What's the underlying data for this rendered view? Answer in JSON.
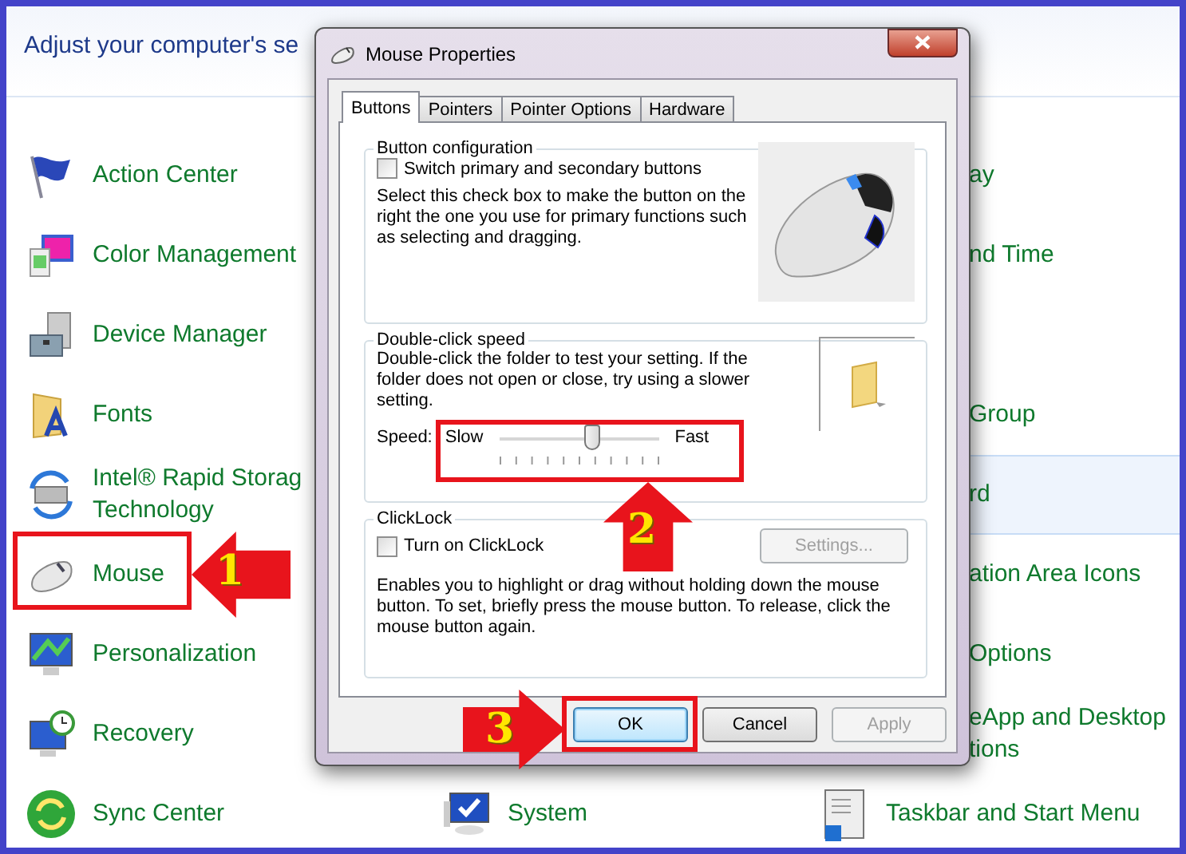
{
  "header": {
    "text": "Adjust your computer's se"
  },
  "rows": [
    {
      "left": {
        "lines": [
          "Action Center"
        ]
      },
      "right": {
        "kind": "clipped",
        "lines": [
          "ay"
        ],
        "highlighted": false
      }
    },
    {
      "left": {
        "lines": [
          "Color Management"
        ]
      },
      "right": {
        "kind": "clipped",
        "lines": [
          "nd Time"
        ],
        "highlighted": false
      }
    },
    {
      "left": {
        "lines": [
          "Device Manager"
        ]
      }
    },
    {
      "left": {
        "lines": [
          "Fonts"
        ]
      },
      "right": {
        "kind": "clipped",
        "lines": [
          "Group"
        ],
        "highlighted": false
      }
    },
    {
      "left": {
        "lines": [
          "Intel® Rapid Storag",
          "Technology"
        ]
      },
      "right": {
        "kind": "clipped",
        "lines": [
          "rd"
        ],
        "highlighted": true
      }
    },
    {
      "left": {
        "lines": [
          "Mouse"
        ]
      },
      "right": {
        "kind": "clipped",
        "lines": [
          "ation Area Icons"
        ],
        "highlighted": false
      }
    },
    {
      "left": {
        "lines": [
          "Personalization"
        ]
      },
      "right": {
        "kind": "clipped",
        "lines": [
          "Options"
        ],
        "highlighted": false
      }
    },
    {
      "left": {
        "lines": [
          "Recovery"
        ]
      },
      "right": {
        "kind": "clipped",
        "lines": [
          "eApp and Desktop",
          "tions"
        ],
        "highlighted": false
      }
    },
    {
      "left": {
        "lines": [
          "Sync Center"
        ]
      },
      "middle": {
        "lines": [
          "System"
        ]
      },
      "right": {
        "kind": "full",
        "lines": [
          "Taskbar and Start Menu"
        ],
        "highlighted": false
      }
    }
  ],
  "dialog": {
    "title": "Mouse Properties",
    "tabs": [
      {
        "label": "Buttons",
        "selected": true
      },
      {
        "label": "Pointers",
        "selected": false
      },
      {
        "label": "Pointer Options",
        "selected": false
      },
      {
        "label": "Hardware",
        "selected": false
      }
    ],
    "button_configuration": {
      "title": "Button configuration",
      "checkbox": {
        "label": "Switch primary and secondary buttons",
        "checked": false
      },
      "description": "Select this check box to make the button on the right the one you use for primary functions such as selecting and dragging."
    },
    "double_click": {
      "title": "Double-click speed",
      "description": "Double-click the folder to test your setting. If the folder does not open or close, try using a slower setting.",
      "speed_label": "Speed:",
      "slow": "Slow",
      "fast": "Fast",
      "level": 0.58
    },
    "clicklock": {
      "title": "ClickLock",
      "checkbox": {
        "label": "Turn on ClickLock",
        "checked": false
      },
      "settings": {
        "label": "Settings...",
        "disabled": true
      },
      "description": "Enables you to highlight or drag without holding down the mouse button. To set, briefly press the mouse button. To release, click the mouse button again."
    },
    "buttons": [
      {
        "label": "OK",
        "kind": "default",
        "disabled": false
      },
      {
        "label": "Cancel",
        "kind": "normal",
        "disabled": false
      },
      {
        "label": "Apply",
        "kind": "normal",
        "disabled": true
      }
    ]
  },
  "annotations": [
    {
      "number": "1",
      "kind": "left"
    },
    {
      "number": "2",
      "kind": "up"
    },
    {
      "number": "3",
      "kind": "right"
    }
  ]
}
